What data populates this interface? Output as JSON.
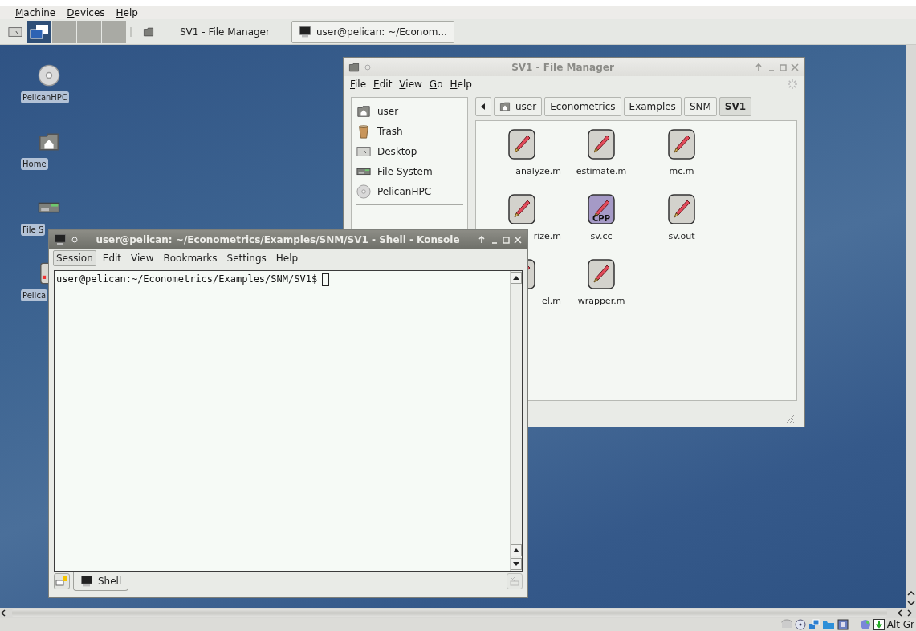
{
  "vm_menu": [
    {
      "label": "Machine"
    },
    {
      "label": "Devices"
    },
    {
      "label": "Help"
    }
  ],
  "taskbar": {
    "desktops": [
      {
        "selected": true
      },
      {
        "selected": false
      },
      {
        "selected": false
      },
      {
        "selected": false
      }
    ],
    "tasks": [
      {
        "label": "SV1 - File Manager",
        "kind": "folder",
        "selected": false
      },
      {
        "label": "user@pelican: ~/Econom...",
        "kind": "terminal",
        "selected": true
      }
    ]
  },
  "desktop_icons": [
    {
      "label": "PelicanHPC",
      "kind": "disc"
    },
    {
      "label": "Home",
      "kind": "home"
    },
    {
      "label": "File S",
      "kind": "drive"
    },
    {
      "label": "Pelica",
      "kind": "document"
    }
  ],
  "file_manager": {
    "title": "SV1 - File Manager",
    "menu": [
      {
        "label": "File"
      },
      {
        "label": "Edit"
      },
      {
        "label": "View"
      },
      {
        "label": "Go"
      },
      {
        "label": "Help"
      }
    ],
    "places": [
      {
        "label": "user",
        "kind": "home"
      },
      {
        "label": "Trash",
        "kind": "trash"
      },
      {
        "label": "Desktop",
        "kind": "desktop"
      },
      {
        "label": "File System",
        "kind": "drive"
      },
      {
        "label": "PelicanHPC",
        "kind": "disc"
      }
    ],
    "path": [
      {
        "label": "user",
        "kind": "home",
        "selected": false
      },
      {
        "label": "Econometrics",
        "kind": "folder",
        "selected": false
      },
      {
        "label": "Examples",
        "kind": "folder",
        "selected": false
      },
      {
        "label": "SNM",
        "kind": "folder",
        "selected": false
      },
      {
        "label": "SV1",
        "kind": "folder",
        "selected": true
      }
    ],
    "files": [
      {
        "name": "analyze.m"
      },
      {
        "name": "estimate.m"
      },
      {
        "name": "mc.m"
      },
      {
        "name": "rize.m"
      },
      {
        "name": "sv.cc",
        "badge": "CPP"
      },
      {
        "name": "sv.out"
      },
      {
        "name": "el.m"
      },
      {
        "name": "wrapper.m"
      }
    ]
  },
  "konsole": {
    "title": "user@pelican: ~/Econometrics/Examples/SNM/SV1 - Shell - Konsole",
    "menu": [
      {
        "label": "Session",
        "selected": true
      },
      {
        "label": "Edit",
        "selected": false
      },
      {
        "label": "View",
        "selected": false
      },
      {
        "label": "Bookmarks",
        "selected": false
      },
      {
        "label": "Settings",
        "selected": false
      },
      {
        "label": "Help",
        "selected": false
      }
    ],
    "prompt": "user@pelican:~/Econometrics/Examples/SNM/SV1$",
    "tabs": [
      {
        "label": "Shell",
        "selected": true
      }
    ]
  },
  "status_bar": {
    "keyboard": "Alt Gr"
  }
}
